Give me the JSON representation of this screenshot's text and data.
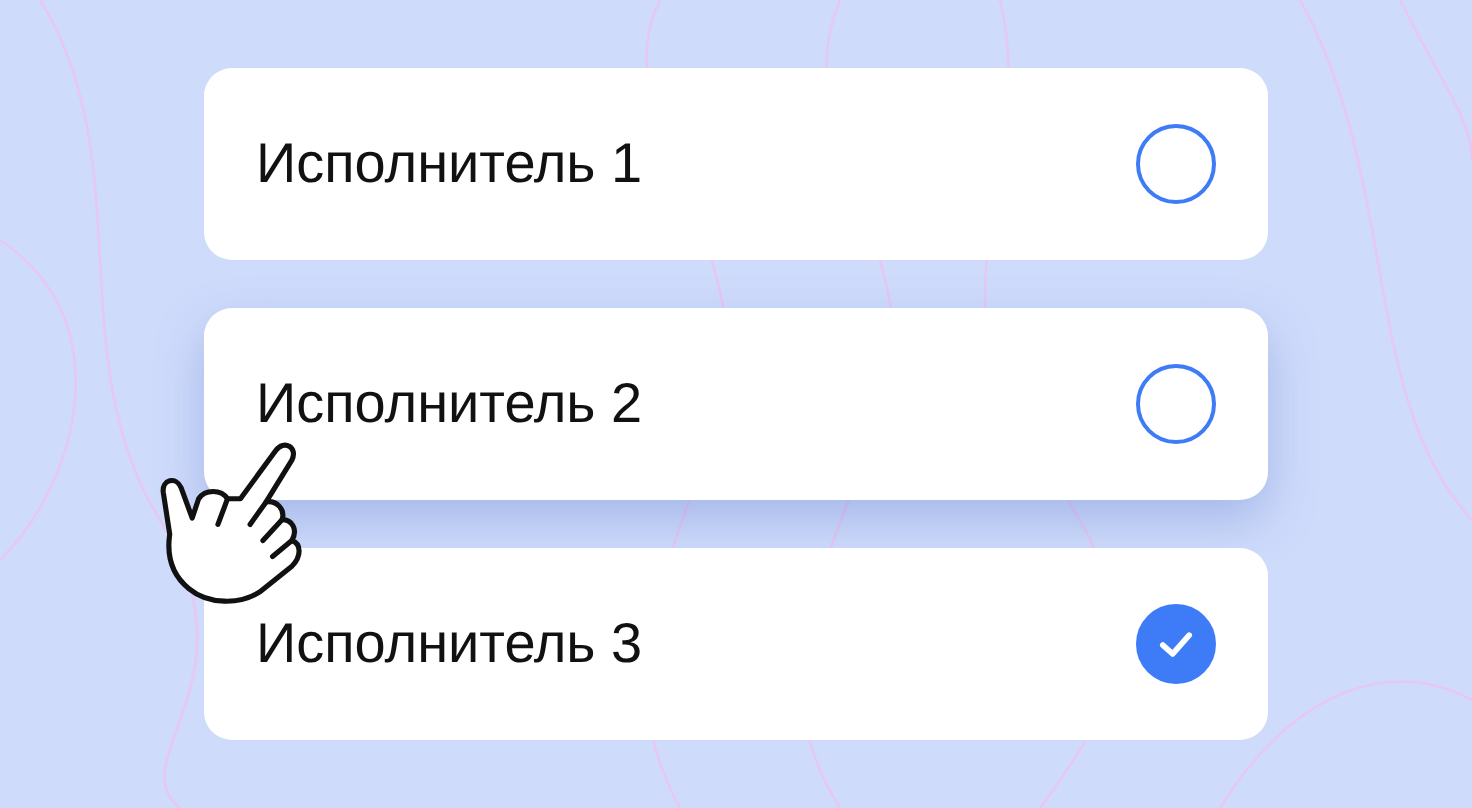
{
  "options": [
    {
      "label": "Исполнитель 1",
      "selected": false,
      "hovered": false
    },
    {
      "label": "Исполнитель 2",
      "selected": false,
      "hovered": true
    },
    {
      "label": "Исполнитель 3",
      "selected": true,
      "hovered": false
    }
  ]
}
